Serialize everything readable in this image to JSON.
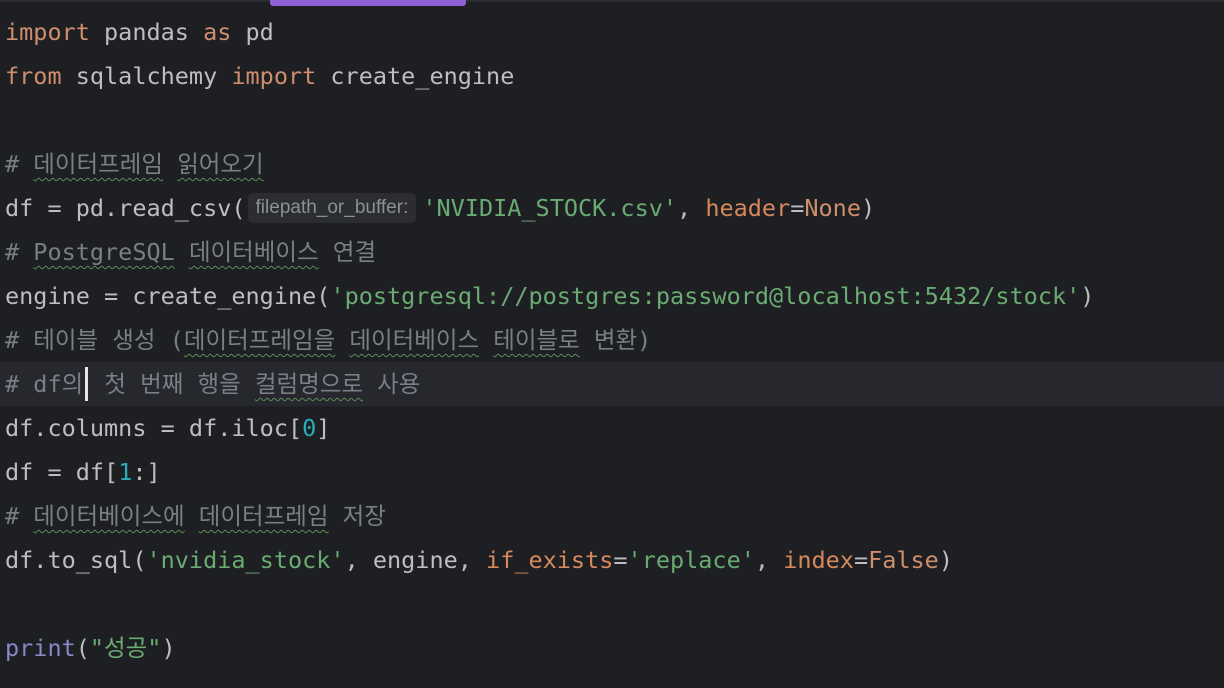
{
  "lines": {
    "l1": {
      "import": "import",
      "module": " pandas ",
      "as": "as",
      "alias": " pd"
    },
    "l2": {
      "from": "from",
      "module": " sqlalchemy ",
      "import": "import",
      "name": " create_engine"
    },
    "l4": {
      "hash": "# ",
      "text": "데이터프레임",
      "space": " ",
      "text2": "읽어오기"
    },
    "l5": {
      "prefix": "df = pd.read_csv(",
      "hint": "filepath_or_buffer:",
      "arg": "'NVIDIA_STOCK.csv'",
      "comma": ", ",
      "kwarg": "header",
      "eq": "=",
      "val": "None",
      "close": ")"
    },
    "l6": {
      "hash": "# ",
      "w1": "PostgreSQL",
      "sp1": " ",
      "w2": "데이터베이스",
      "rest": " 연결"
    },
    "l7": {
      "prefix": "engine = create_engine(",
      "arg": "'postgresql://postgres:password@localhost:5432/stock'",
      "close": ")"
    },
    "l8": {
      "hash": "# 테이블 생성 (",
      "w1": "데이터프레임을",
      "sp1": " ",
      "w2": "데이터베이스",
      "sp2": " ",
      "w3": "테이블로",
      "rest": " 변환)"
    },
    "l9": {
      "hash": "# df의",
      "mid": " 첫 번째 행을 ",
      "w1": "컬럼명으로",
      "rest": " 사용"
    },
    "l10": {
      "prefix": "df.columns = df.iloc[",
      "num": "0",
      "close": "]"
    },
    "l11": {
      "prefix": "df = df[",
      "num": "1",
      "close": ":]"
    },
    "l12": {
      "hash": "# ",
      "w1": "데이터베이스에",
      "sp1": " ",
      "w2": "데이터프레임",
      "rest": " 저장"
    },
    "l13": {
      "prefix": "df.to_sql(",
      "arg1": "'nvidia_stock'",
      "mid": ", engine, ",
      "kw1": "if_exists",
      "eq1": "=",
      "arg2": "'replace'",
      "comma": ", ",
      "kw2": "index",
      "eq2": "=",
      "val": "False",
      "close": ")"
    },
    "l15": {
      "fn": "print",
      "open": "(",
      "arg": "\"성공\"",
      "close": ")"
    }
  },
  "colors": {
    "background": "#1e1f22",
    "keyword": "#cf8e6d",
    "string": "#6aab73",
    "number": "#2aacb8",
    "comment": "#7a7e85",
    "named_arg": "#c77dbb",
    "tab_accent": "#8f5fd6"
  }
}
